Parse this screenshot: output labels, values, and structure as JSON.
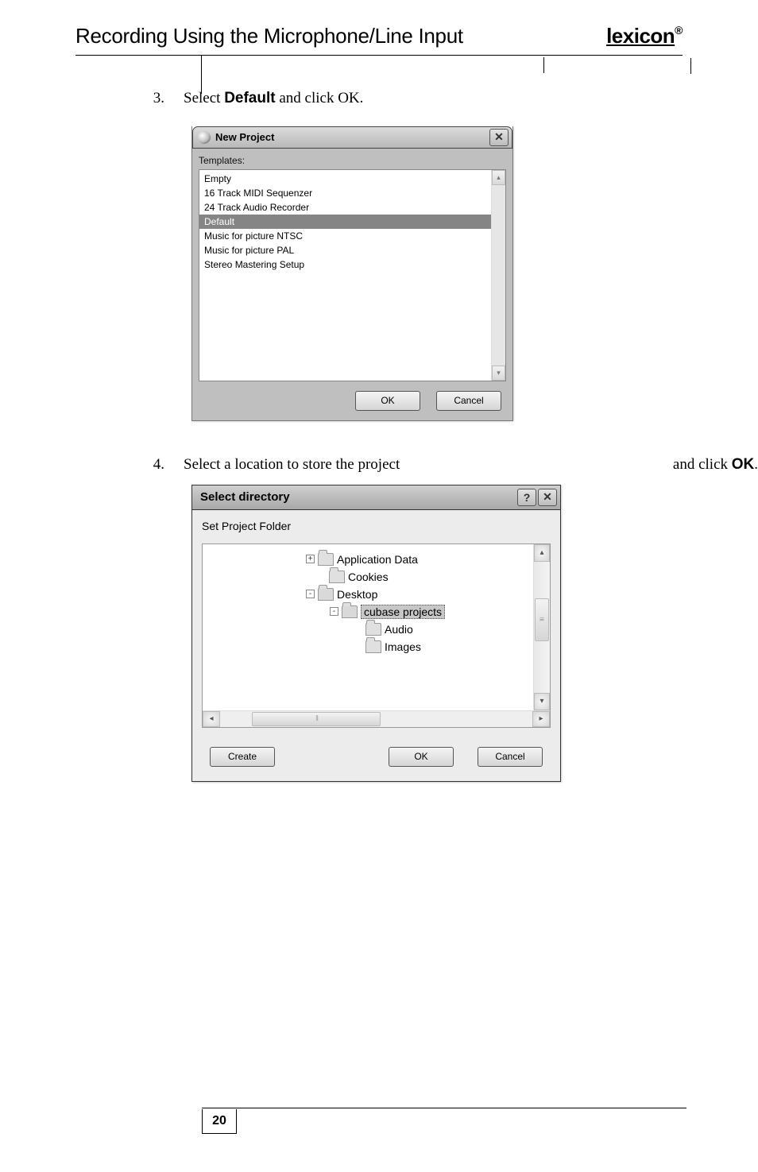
{
  "header": {
    "section_title": "Recording Using the Microphone/Line Input",
    "brand": "lexicon"
  },
  "step3": {
    "num": "3.",
    "text_before": "Select ",
    "bold": "Default",
    "text_after": " and click OK."
  },
  "dialog1": {
    "title": "New Project",
    "label": "Templates:",
    "items": [
      "Empty",
      "16 Track MIDI Sequenzer",
      "24 Track Audio Recorder",
      "Default",
      "Music for picture NTSC",
      "Music for picture PAL",
      "Stereo Mastering Setup"
    ],
    "selected_index": 3,
    "ok": "OK",
    "cancel": "Cancel"
  },
  "step4": {
    "num": "4.",
    "left_text": "Select a location to store the project",
    "right_text_before": "and click ",
    "right_bold": "OK",
    "right_after": "."
  },
  "dialog2": {
    "title": "Select directory",
    "subtitle": "Set Project Folder",
    "tree": [
      {
        "indent": 130,
        "expander": "+",
        "label": "Application Data",
        "open": false
      },
      {
        "indent": 144,
        "expander": "",
        "label": "Cookies",
        "open": false
      },
      {
        "indent": 130,
        "expander": "-",
        "label": "Desktop",
        "open": true
      },
      {
        "indent": 160,
        "expander": "-",
        "label": "cubase projects",
        "open": true,
        "selected": true
      },
      {
        "indent": 190,
        "expander": "",
        "label": "Audio",
        "open": false
      },
      {
        "indent": 190,
        "expander": "",
        "label": "Images",
        "open": false
      }
    ],
    "create": "Create",
    "ok": "OK",
    "cancel": "Cancel"
  },
  "page_number": "20"
}
